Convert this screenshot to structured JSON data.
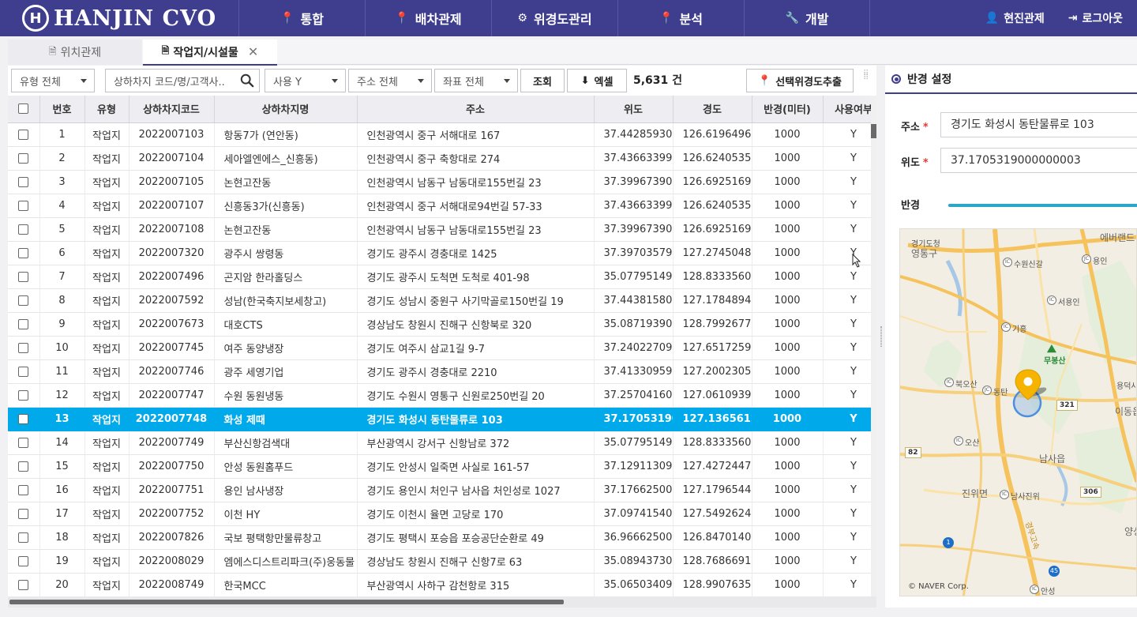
{
  "header": {
    "logo_mark": "H",
    "logo_text": "HANJIN CVO",
    "nav": [
      {
        "label": "통합",
        "icon": "map-pin-icon"
      },
      {
        "label": "배차관제",
        "icon": "map-pin-icon"
      },
      {
        "label": "위경도관리",
        "icon": "gears-icon"
      },
      {
        "label": "분석",
        "icon": "map-pin-icon"
      },
      {
        "label": "개발",
        "icon": "wrench-icon"
      }
    ],
    "user_label": "현진관제",
    "logout_label": "로그아웃"
  },
  "tabs": {
    "tab1_label": "위치관제",
    "tab2_label": "작업지/시설물"
  },
  "filters": {
    "type_select": "유형 전체",
    "search_placeholder": "상하차지 코드/명/고객사..",
    "use_select": "사용 Y",
    "address_select": "주소 전체",
    "coord_select": "좌표 전체",
    "search_button": "조회",
    "excel_button": "엑셀",
    "count": "5,631 건",
    "extract_button": "선택위경도추출"
  },
  "table": {
    "columns": [
      "번호",
      "유형",
      "상하차지코드",
      "상하차지명",
      "주소",
      "위도",
      "경도",
      "반경(미터)",
      "사용여부"
    ],
    "rows": [
      [
        "1",
        "작업지",
        "2022007103",
        "항동7가 (연안동)",
        "인천광역시 중구 서해대로 167",
        "37.442859300",
        "126.61964960",
        "1000",
        "Y"
      ],
      [
        "2",
        "작업지",
        "2022007104",
        "세아엘엔에스_신흥동)",
        "인천광역시 중구 축항대로 274",
        "37.436633999",
        "126.62405350",
        "1000",
        "Y"
      ],
      [
        "3",
        "작업지",
        "2022007105",
        "논현고잔동",
        "인천광역시 남동구 남동대로155번길 23",
        "37.399673900",
        "126.69251699",
        "1000",
        "Y"
      ],
      [
        "4",
        "작업지",
        "2022007107",
        "신흥동3가(신흥동)",
        "인천광역시 중구 서해대로94번길 57-33",
        "37.436633999",
        "126.62405350",
        "1000",
        "Y"
      ],
      [
        "5",
        "작업지",
        "2022007108",
        "논현고잔동",
        "인천광역시 남동구 남동대로155번길 23",
        "37.399673900",
        "126.69251699",
        "1000",
        "Y"
      ],
      [
        "6",
        "작업지",
        "2022007320",
        "광주시 쌍령동",
        "경기도 광주시 경충대로 1425",
        "37.397035799",
        "127.27450489",
        "1000",
        "Y"
      ],
      [
        "7",
        "작업지",
        "2022007496",
        "곤지암 한라홀딩스",
        "경기도 광주시 도척면 도척로 401-98",
        "35.077951499",
        "128.83335600",
        "1000",
        "Y"
      ],
      [
        "8",
        "작업지",
        "2022007592",
        "성남(한국축지보세창고)",
        "경기도 성남시 중원구 사기막골로150번길 19",
        "37.443815800",
        "127.17848949",
        "1000",
        "Y"
      ],
      [
        "9",
        "작업지",
        "2022007673",
        "대호CTS",
        "경상남도 창원시 진해구 신항북로 320",
        "35.087193900",
        "128.79926770",
        "1000",
        "Y"
      ],
      [
        "10",
        "작업지",
        "2022007745",
        "여주 동양냉장",
        "경기도 여주시 삼교1길 9-7",
        "37.240227099",
        "127.65172590",
        "1000",
        "Y"
      ],
      [
        "11",
        "작업지",
        "2022007746",
        "광주 세영기업",
        "경기도 광주시 경충대로 2210",
        "37.413309599",
        "127.20023059",
        "1000",
        "Y"
      ],
      [
        "12",
        "작업지",
        "2022007747",
        "수원 동원냉동",
        "경기도 수원시 영통구 신원로250번길 20",
        "37.257041600",
        "127.06109390",
        "1000",
        "Y"
      ],
      [
        "13",
        "작업지",
        "2022007748",
        "화성 제때",
        "경기도 화성시 동탄물류로 103",
        "37.170531900",
        "127.13656120",
        "1000",
        "Y"
      ],
      [
        "14",
        "작업지",
        "2022007749",
        "부산신항검색대",
        "부산광역시 강서구 신항남로 372",
        "35.077951499",
        "128.83335600",
        "1000",
        "Y"
      ],
      [
        "15",
        "작업지",
        "2022007750",
        "안성 동원홈푸드",
        "경기도 안성시 일죽면 사실로 161-57",
        "37.129113099",
        "127.42724470",
        "1000",
        "Y"
      ],
      [
        "16",
        "작업지",
        "2022007751",
        "용인 남사냉장",
        "경기도 용인시 처인구 남사읍 처인성로 1027",
        "37.176625000",
        "127.17965440",
        "1000",
        "Y"
      ],
      [
        "17",
        "작업지",
        "2022007752",
        "이천 HY",
        "경기도 이천시 율면 고당로 170",
        "37.097415400",
        "127.54926249",
        "1000",
        "Y"
      ],
      [
        "18",
        "작업지",
        "2022007826",
        "국보 평택항만물류창고",
        "경기도 평택시 포승읍 포승공단순환로 49",
        "36.966625000",
        "126.84701400",
        "1000",
        "Y"
      ],
      [
        "19",
        "작업지",
        "2022008029",
        "엠에스디스트리파크(주)웅동물",
        "경상남도 창원시 진해구 신항7로 63",
        "35.089437300",
        "128.76866910",
        "1000",
        "Y"
      ],
      [
        "20",
        "작업지",
        "2022008749",
        "한국MCC",
        "부산광역시 사하구 감천항로 315",
        "35.065034099",
        "128.99076350",
        "1000",
        "Y"
      ]
    ],
    "selected_row": "13"
  },
  "panel": {
    "title": "반경 설정",
    "address_label": "주소",
    "address_value": "경기도 화성시 동탄물류로 103",
    "lat_label": "위도",
    "lat_value": "37.1705319000000003",
    "radius_label": "반경",
    "required_mark": "*"
  },
  "map": {
    "labels": {
      "gyeonggi_hall": "경기도청",
      "yeongtong": "영통구",
      "everland": "에버랜드",
      "suwon_ic": "수원신갈",
      "yongin_jc": "용인",
      "seoyongin": "서용인",
      "giheung": "기흥",
      "mubongsan": "무봉산",
      "bugosan": "북오산",
      "dongtan": "동탄",
      "yongdeoksa": "용덕사",
      "idong": "이동읍",
      "osan": "오산",
      "namsa": "남사읍",
      "jinwi": "진위면",
      "namsajinwi": "남사진위",
      "yangseong": "양성",
      "expressway": "경부고속",
      "anseong": "안성",
      "ic": "IC",
      "jc": "JC",
      "road_321": "321",
      "road_82": "82",
      "road_306": "306",
      "road_1": "1",
      "road_45": "45"
    },
    "copyright": "© NAVER Corp."
  }
}
